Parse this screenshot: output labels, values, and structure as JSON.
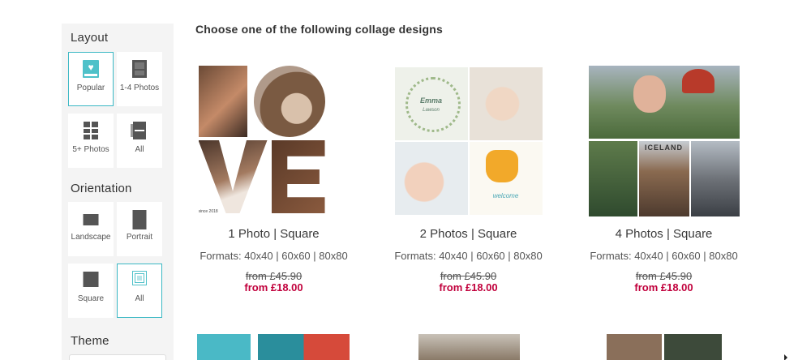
{
  "sidebar": {
    "layout_heading": "Layout",
    "layout_options": [
      {
        "label": "Popular",
        "icon": "heart-photo-icon",
        "selected": true
      },
      {
        "label": "1-4 Photos",
        "icon": "few-photos-icon",
        "selected": false
      },
      {
        "label": "5+ Photos",
        "icon": "grid-photos-icon",
        "selected": false
      },
      {
        "label": "All",
        "icon": "all-layouts-icon",
        "selected": false
      }
    ],
    "orientation_heading": "Orientation",
    "orientation_options": [
      {
        "label": "Landscape",
        "icon": "landscape-icon",
        "selected": false
      },
      {
        "label": "Portrait",
        "icon": "portrait-icon",
        "selected": false
      },
      {
        "label": "Square",
        "icon": "square-icon",
        "selected": false
      },
      {
        "label": "All",
        "icon": "all-orientations-icon",
        "selected": true
      }
    ],
    "theme_heading": "Theme"
  },
  "main": {
    "title": "Choose one of the following collage designs",
    "cards": [
      {
        "title": "1 Photo | Square",
        "formats": "Formats: 40x40 | 60x60 | 80x80",
        "old_price": "from £45.90",
        "new_price": "from £18.00",
        "image_caption": "since 2018"
      },
      {
        "title": "2 Photos | Square",
        "formats": "Formats: 40x40 | 60x60 | 80x80",
        "old_price": "from £45.90",
        "new_price": "from £18.00",
        "image_name": "Emma",
        "image_surname": "Lawson",
        "image_welcome": "welcome"
      },
      {
        "title": "4 Photos | Square",
        "formats": "Formats: 40x40 | 60x60 | 80x80",
        "old_price": "from £45.90",
        "new_price": "from £18.00",
        "image_label": "ICELAND"
      }
    ]
  },
  "colors": {
    "accent": "#3bb8c4",
    "price": "#c1003c",
    "sidebar_bg": "#f4f4f4"
  }
}
